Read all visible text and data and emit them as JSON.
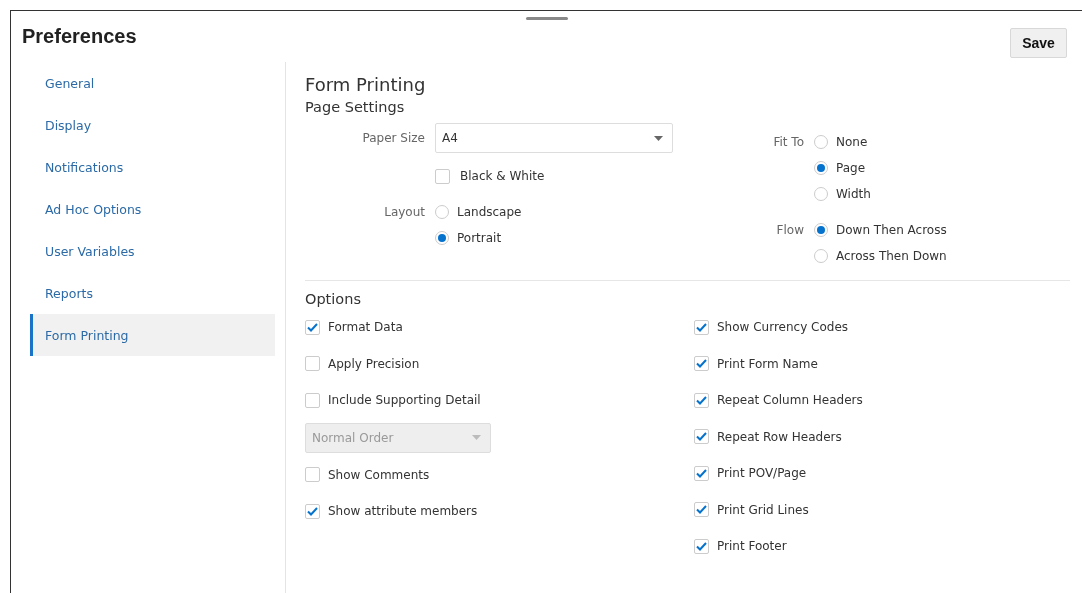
{
  "title": "Preferences",
  "save_button": "Save",
  "sidebar": {
    "items": [
      {
        "label": "General",
        "selected": false
      },
      {
        "label": "Display",
        "selected": false
      },
      {
        "label": "Notifications",
        "selected": false
      },
      {
        "label": "Ad Hoc Options",
        "selected": false
      },
      {
        "label": "User Variables",
        "selected": false
      },
      {
        "label": "Reports",
        "selected": false
      },
      {
        "label": "Form Printing",
        "selected": true
      }
    ]
  },
  "content": {
    "title": "Form Printing",
    "page_settings": {
      "heading": "Page Settings",
      "paper_size": {
        "label": "Paper Size",
        "value": "A4"
      },
      "black_white": {
        "label": "Black & White",
        "checked": false
      },
      "layout": {
        "label": "Layout",
        "options": [
          {
            "label": "Landscape",
            "selected": false
          },
          {
            "label": "Portrait",
            "selected": true
          }
        ]
      },
      "fit_to": {
        "label": "Fit To",
        "options": [
          {
            "label": "None",
            "selected": false
          },
          {
            "label": "Page",
            "selected": true
          },
          {
            "label": "Width",
            "selected": false
          }
        ]
      },
      "flow": {
        "label": "Flow",
        "options": [
          {
            "label": "Down Then Across",
            "selected": true
          },
          {
            "label": "Across Then Down",
            "selected": false
          }
        ]
      }
    },
    "options": {
      "heading": "Options",
      "left": [
        {
          "kind": "checkbox",
          "label": "Format Data",
          "checked": true
        },
        {
          "kind": "checkbox",
          "label": "Apply Precision",
          "checked": false
        },
        {
          "kind": "checkbox",
          "label": "Include Supporting Detail",
          "checked": false
        },
        {
          "kind": "dropdown",
          "value": "Normal Order",
          "disabled": true
        },
        {
          "kind": "checkbox",
          "label": "Show Comments",
          "checked": false
        },
        {
          "kind": "checkbox",
          "label": "Show attribute members",
          "checked": true
        }
      ],
      "right": [
        {
          "kind": "checkbox",
          "label": "Show Currency Codes",
          "checked": true
        },
        {
          "kind": "checkbox",
          "label": "Print Form Name",
          "checked": true
        },
        {
          "kind": "checkbox",
          "label": "Repeat Column Headers",
          "checked": true
        },
        {
          "kind": "checkbox",
          "label": "Repeat Row Headers",
          "checked": true
        },
        {
          "kind": "checkbox",
          "label": "Print POV/Page",
          "checked": true
        },
        {
          "kind": "checkbox",
          "label": "Print Grid Lines",
          "checked": true
        },
        {
          "kind": "checkbox",
          "label": "Print Footer",
          "checked": true
        }
      ]
    }
  }
}
